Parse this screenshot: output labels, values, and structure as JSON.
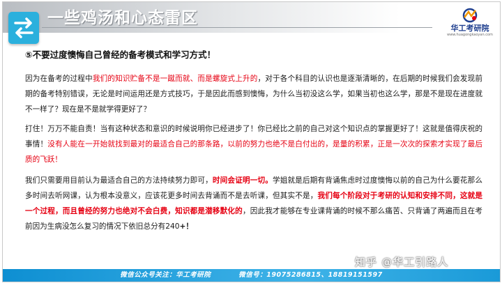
{
  "header": {
    "title": "一些鸡汤和心态雷区"
  },
  "logo": {
    "name": "华工考研院",
    "url": "www.huagongkaoyan.com"
  },
  "content": {
    "heading": "⑤不要过度懊悔自己曾经的备考模式和学习方式！",
    "para1": {
      "t1": "因为在备考的过程中",
      "t2": "我们的知识贮备不是一蹴而就、而是螺旋式上升的",
      "t3": "，对于各个科目的认识也是逐渐清晰的，在后期的时候我们会发现前期的备考特别错误，无论是时间运用还是方式技巧，于是因此而感到懊悔，为什么当初没这么学，如果当初也这么学，那是不是现在进度就不一样了？现在是不是就学得更好了？"
    },
    "para2": {
      "t1": "打住！万万不能自责！当有这种状态和意识的时候说明你已经进步了！你已经比之前的自己对这个知识点的掌握更好了！这就是值得庆祝的事情！",
      "t2": "没有人能在一开始就找到最对的最适合自己的那条路，以前的努力也绝不是白付出的，是量的积累，正是一次次的探索才实现了最后质的飞跃！"
    },
    "para3": {
      "t1": "我们只需要用目前认为最适合自己的方法持续努力即可，",
      "t2": "时间会证明一切。",
      "t3": "学姐就是后期有背诵焦虑时过度懊悔以前的自己为什么要花那么多时间去听网课，认为根本没意义，应该花更多时间去背诵而不是去听课，但其实不是，",
      "t4": "我们每个阶段对于考研的认知和安排不同，这就是一个过程，而且曾经的努力也绝对不会白费，知识都是潜移默化的",
      "t5": "，因此我才能够在专业课背诵的时候不那么痛苦、只背诵了两遍而且在考前因为生病没怎么复习的情况下依旧总分有240",
      "t6": "+！"
    }
  },
  "footer": {
    "text": "微信公众号关注：华工考研院　　　　微信号：19075286815、18819151597"
  },
  "watermark": {
    "text": "知乎 @华工引路人"
  },
  "colors": {
    "accent_red": "#e60012",
    "header_blue": "#2bb0dd",
    "footer_blue": "#0e8fd2"
  }
}
